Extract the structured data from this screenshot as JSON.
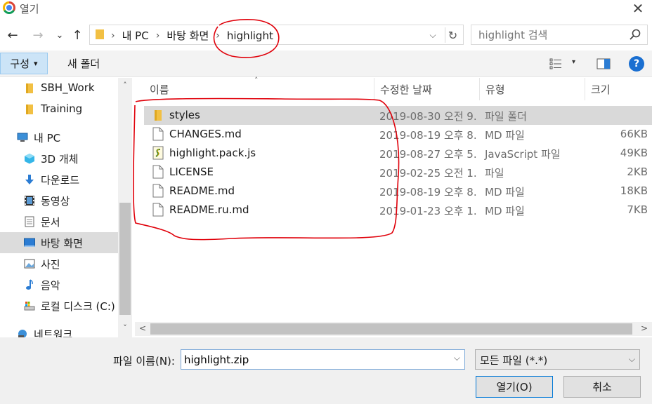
{
  "window": {
    "title": "열기",
    "close_glyph": "✕"
  },
  "nav": {
    "back": "←",
    "forward": "→",
    "recent": "⌄",
    "up": "↑",
    "breadcrumbs": [
      "내 PC",
      "바탕 화면",
      "highlight"
    ],
    "sep": "›",
    "dropdown": "⌵",
    "refresh": "↻",
    "search_placeholder": "highlight 검색"
  },
  "toolbar": {
    "organize_label": "구성",
    "organize_caret": "▾",
    "new_folder_label": "새 폴더",
    "view_caret": "▾",
    "help_label": "?"
  },
  "sidebar": {
    "items": [
      {
        "label": "SBH_Work",
        "icon": "folder-icon"
      },
      {
        "label": "Training",
        "icon": "folder-icon"
      },
      {
        "label": "내 PC",
        "icon": "computer-icon"
      },
      {
        "label": "3D 개체",
        "icon": "cube-icon"
      },
      {
        "label": "다운로드",
        "icon": "download-icon"
      },
      {
        "label": "동영상",
        "icon": "video-icon"
      },
      {
        "label": "문서",
        "icon": "document-icon"
      },
      {
        "label": "바탕 화면",
        "icon": "desktop-icon",
        "selected": true
      },
      {
        "label": "사진",
        "icon": "picture-icon"
      },
      {
        "label": "음악",
        "icon": "music-icon"
      },
      {
        "label": "로컬 디스크 (C:)",
        "icon": "drive-icon"
      },
      {
        "label": "네트워크",
        "icon": "network-icon"
      }
    ],
    "scroll_up": "˄",
    "scroll_down": "˅"
  },
  "columns": {
    "name": "이름",
    "date": "수정한 날짜",
    "type": "유형",
    "size": "크기",
    "sort_arrow": "˄"
  },
  "files": [
    {
      "name": "styles",
      "date": "2019-08-30 오전 9...",
      "type": "파일 폴더",
      "size": "",
      "icon": "folder-icon",
      "selected": true
    },
    {
      "name": "CHANGES.md",
      "date": "2019-08-19 오후 8...",
      "type": "MD 파일",
      "size": "66KB",
      "icon": "file-icon"
    },
    {
      "name": "highlight.pack.js",
      "date": "2019-08-27 오후 5...",
      "type": "JavaScript 파일",
      "size": "49KB",
      "icon": "script-icon"
    },
    {
      "name": "LICENSE",
      "date": "2019-02-25 오전 1...",
      "type": "파일",
      "size": "2KB",
      "icon": "file-icon"
    },
    {
      "name": "README.md",
      "date": "2019-08-19 오후 8...",
      "type": "MD 파일",
      "size": "18KB",
      "icon": "file-icon"
    },
    {
      "name": "README.ru.md",
      "date": "2019-01-23 오후 1...",
      "type": "MD 파일",
      "size": "7KB",
      "icon": "file-icon"
    }
  ],
  "hscroll": {
    "left": "<",
    "right": ">"
  },
  "footer": {
    "filename_label": "파일 이름(N):",
    "filename_value": "highlight.zip",
    "filename_dd": "⌵",
    "filter_value": "모든 파일 (*.*)",
    "filter_dd": "⌵",
    "open_label": "열기(O)",
    "cancel_label": "취소"
  },
  "colors": {
    "annotation": "#e0000a",
    "selection": "#d9d9d9",
    "accent": "#0078d7",
    "folder": "#f2c043"
  }
}
